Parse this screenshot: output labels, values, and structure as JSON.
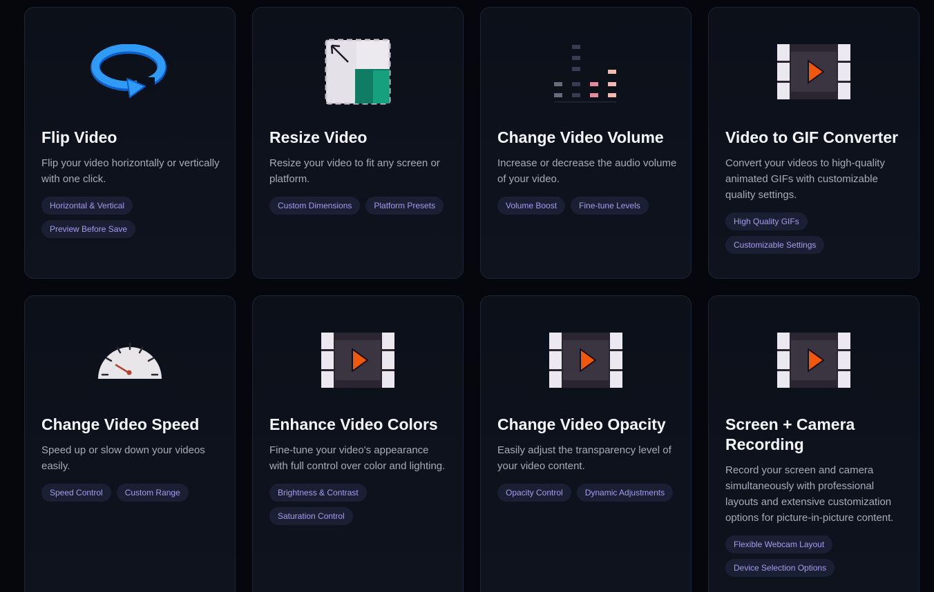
{
  "cards": [
    {
      "icon": "flip-rotate-icon",
      "title": "Flip Video",
      "description": "Flip your video horizontally or vertically with one click.",
      "tags": [
        "Horizontal & Vertical",
        "Preview Before Save"
      ]
    },
    {
      "icon": "resize-icon",
      "title": "Resize Video",
      "description": "Resize your video to fit any screen or platform.",
      "tags": [
        "Custom Dimensions",
        "Platform Presets"
      ]
    },
    {
      "icon": "volume-bars-icon",
      "title": "Change Video Volume",
      "description": "Increase or decrease the audio volume of your video.",
      "tags": [
        "Volume Boost",
        "Fine-tune Levels"
      ]
    },
    {
      "icon": "film-play-icon",
      "title": "Video to GIF Converter",
      "description": "Convert your videos to high-quality animated GIFs with customizable quality settings.",
      "tags": [
        "High Quality GIFs",
        "Customizable Settings"
      ]
    },
    {
      "icon": "speedometer-icon",
      "title": "Change Video Speed",
      "description": "Speed up or slow down your videos easily.",
      "tags": [
        "Speed Control",
        "Custom Range"
      ]
    },
    {
      "icon": "film-play-icon",
      "title": "Enhance Video Colors",
      "description": "Fine-tune your video's appearance with full control over color and lighting.",
      "tags": [
        "Brightness & Contrast",
        "Saturation Control"
      ]
    },
    {
      "icon": "film-play-icon",
      "title": "Change Video Opacity",
      "description": "Easily adjust the transparency level of your video content.",
      "tags": [
        "Opacity Control",
        "Dynamic Adjustments"
      ]
    },
    {
      "icon": "film-play-icon",
      "title": "Screen + Camera Recording",
      "description": "Record your screen and camera simultaneously with professional layouts and extensive customization options for picture-in-picture content.",
      "tags": [
        "Flexible Webcam Layout",
        "Device Selection Options"
      ]
    }
  ],
  "colors": {
    "background": "#05070c",
    "card": "#0d111b",
    "tag_bg": "#1a1f33",
    "tag_text": "#a99bf0",
    "accent_orange": "#f2580c",
    "accent_blue": "#2f9bf5",
    "accent_teal": "#0f8a6e"
  }
}
